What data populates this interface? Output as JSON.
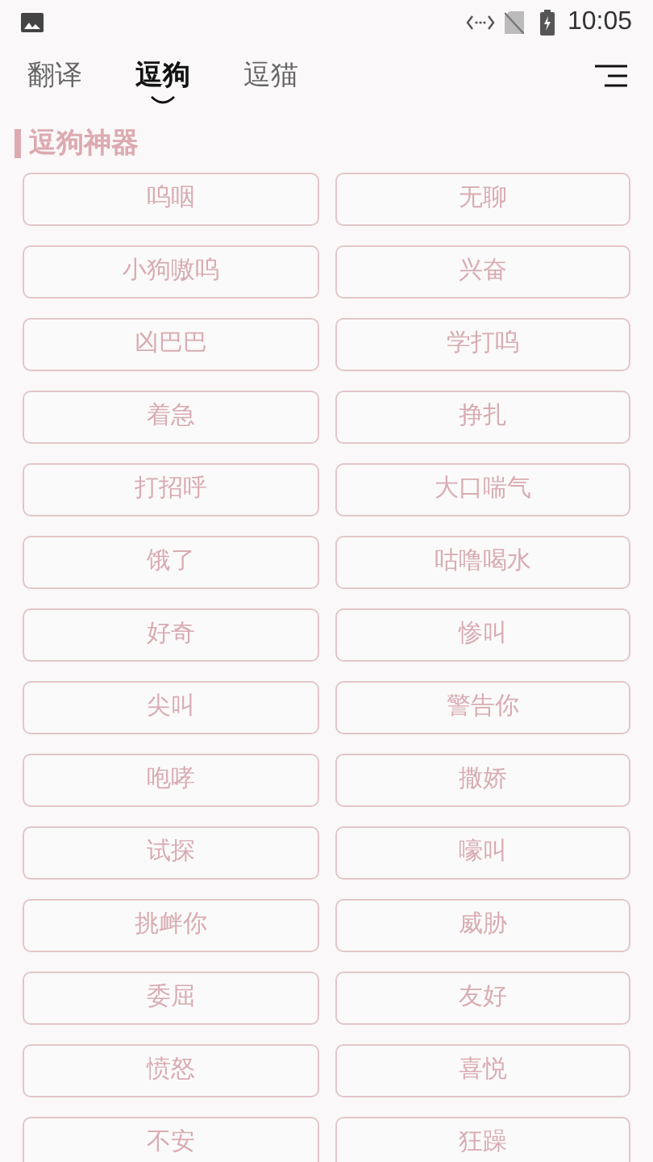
{
  "status_bar": {
    "time": "10:05"
  },
  "tabs": [
    {
      "label": "翻译",
      "selected": false
    },
    {
      "label": "逗狗",
      "selected": true
    },
    {
      "label": "逗猫",
      "selected": false
    }
  ],
  "section": {
    "title": "逗狗神器"
  },
  "sounds": [
    "呜咽",
    "无聊",
    "小狗嗷呜",
    "兴奋",
    "凶巴巴",
    "学打呜",
    "着急",
    "挣扎",
    "打招呼",
    "大口喘气",
    "饿了",
    "咕噜喝水",
    "好奇",
    "惨叫",
    "尖叫",
    "警告你",
    "咆哮",
    "撒娇",
    "试探",
    "嚎叫",
    "挑衅你",
    "威胁",
    "委屈",
    "友好",
    "愤怒",
    "喜悦",
    "不安",
    "狂躁"
  ]
}
